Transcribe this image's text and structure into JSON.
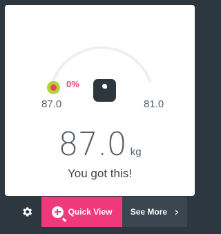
{
  "progress": {
    "percent_label": "0%",
    "percent_value": 0
  },
  "weights": {
    "start": "87.0",
    "goal": "81.0",
    "current": "87.0",
    "unit": "kg"
  },
  "message": "You got this!",
  "actions": {
    "quick_view_label": "Quick View",
    "see_more_label": "See More"
  },
  "icons": {
    "scale": "scale-icon",
    "settings": "gear-icon",
    "quick_view": "zoom-plus-icon",
    "see_more": "chevron-right-icon"
  },
  "colors": {
    "accent": "#f0397a",
    "start_marker": "#b5d334",
    "dark": "#2d373f"
  }
}
